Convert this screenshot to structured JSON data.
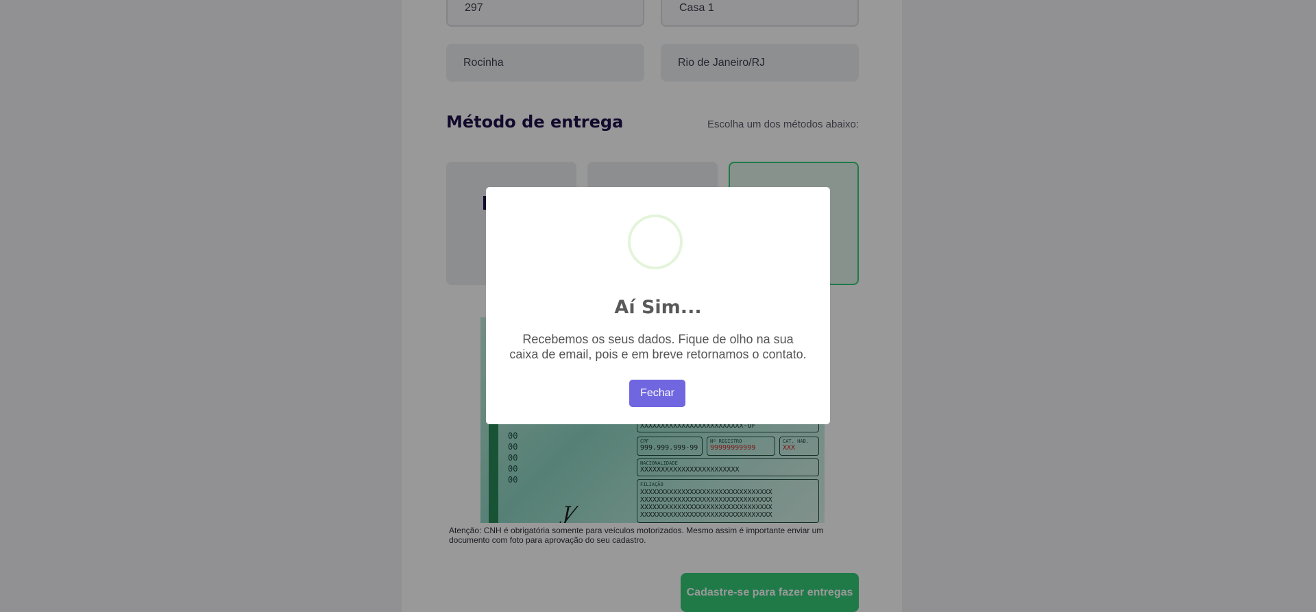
{
  "form": {
    "number_value": "297",
    "complement_value": "Casa 1",
    "neighborhood_value": "Rocinha",
    "city_value": "Rio de Janeiro/RJ"
  },
  "delivery": {
    "title": "Método de entrega",
    "hint": "Escolha um dos métodos abaixo:"
  },
  "cnh": {
    "zeros": "0000000000",
    "name_line": "XXXXXXXXXXXXXXXXXXXXXXXXX-UF",
    "cpf_label": "CPF",
    "cpf_value": "999.999.999-99",
    "registro_label": "Nº REGISTRO",
    "registro_value": "99999999999",
    "cat_label": "CAT. HAB.",
    "cat_value": "XXX",
    "nacionalidade_label": "NACIONALIDADE",
    "nacionalidade_value": "XXXXXXXXXXXXXXXXXXXXXXXX",
    "filiacao_label": "FILIAÇÃO",
    "filiacao_lines": [
      "XXXXXXXXXXXXXXXXXXXXXXXXXXXXXXXX",
      "XXXXXXXXXXXXXXXXXXXXXXXXXXXXXXXX",
      "XXXXXXXXXXXXXXXXXXXXXXXXXXXXXXXX",
      "XXXXXXXXXXXXXXXXXXXXXXXXXXXXXXXX"
    ]
  },
  "notice": "Atenção: CNH é obrigatória somente para veículos motorizados. Mesmo assim é importante enviar um documento com foto para aprovação do seu cadastro.",
  "submit_label": "Cadastre-se para fazer entregas",
  "modal": {
    "title": "Aí Sim...",
    "text": "Recebemos os seus dados. Fique de olho na sua caixa de email, pois e em breve retornamos o contato.",
    "close_label": "Fechar",
    "icon": "success-circle-icon"
  },
  "colors": {
    "accent_green": "#34cb79",
    "modal_button": "#7066e0",
    "title": "#1f0f4a"
  }
}
